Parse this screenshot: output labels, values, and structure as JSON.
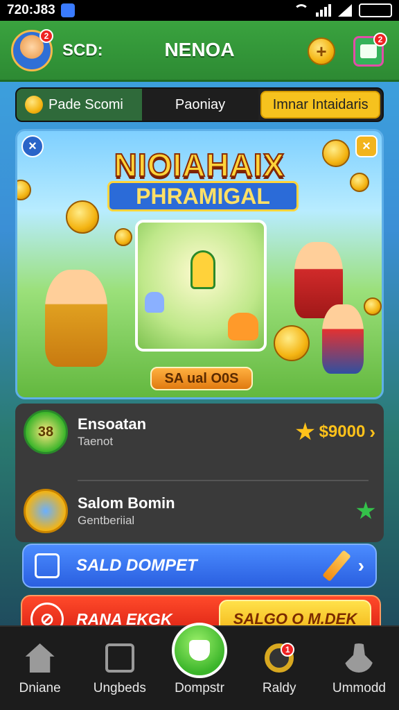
{
  "status": {
    "time": "720:J83"
  },
  "header": {
    "score_label": "SCD:",
    "title": "NENOA",
    "avatar_badge": "2",
    "menu_badge": "2",
    "coin_button_symbol": "+"
  },
  "tabs": [
    {
      "label": "Pade Scomi"
    },
    {
      "label": "Paoniay"
    },
    {
      "label": "Imnar Intaidaris"
    }
  ],
  "banner": {
    "title_line1": "NIOIAHAIX",
    "title_line2": "PHRAMIGAL",
    "button_label": "SA ual O0S"
  },
  "rows": [
    {
      "icon_text": "38",
      "title": "Ensoatan",
      "subtitle": "Taenot",
      "value": "$9000"
    },
    {
      "title": "Salom Bomin",
      "subtitle": "Gentberiial"
    }
  ],
  "actions": {
    "blue_label": "SALD DOMPET",
    "red_label": "RANA EKGK",
    "red_cta": "SALGO O M.DEK"
  },
  "nav": [
    {
      "label": "Dniane",
      "icon": "home-icon"
    },
    {
      "label": "Ungbeds",
      "icon": "clipboard-icon"
    },
    {
      "label": "Dompstr",
      "icon": "wallet-icon"
    },
    {
      "label": "Raldy",
      "icon": "ring-icon",
      "badge": "1"
    },
    {
      "label": "Ummodd",
      "icon": "person-icon"
    }
  ],
  "colors": {
    "header_green": "#3aa33f",
    "accent_yellow": "#f6c21e",
    "blue_button": "#2a5fe0",
    "red_button": "#d41a10"
  }
}
